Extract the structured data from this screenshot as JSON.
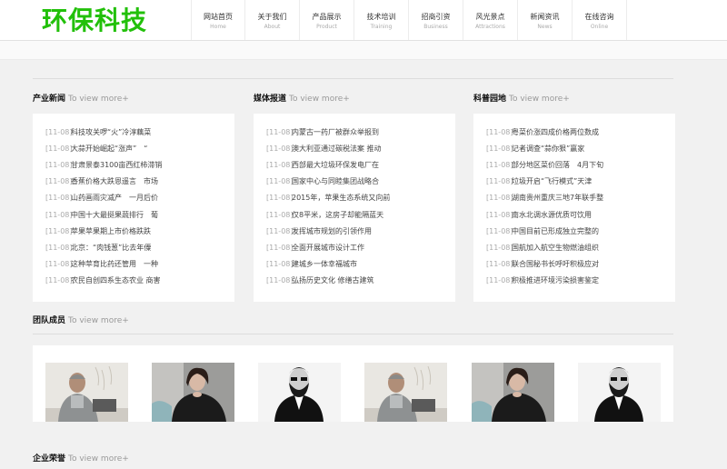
{
  "logo": "环保科技",
  "nav": [
    {
      "cn": "网站首页",
      "en": "Home"
    },
    {
      "cn": "关于我们",
      "en": "About"
    },
    {
      "cn": "产品展示",
      "en": "Product"
    },
    {
      "cn": "技术培训",
      "en": "Training"
    },
    {
      "cn": "招商引资",
      "en": "Business"
    },
    {
      "cn": "风光景点",
      "en": "Attractions"
    },
    {
      "cn": "新闻资讯",
      "en": "News"
    },
    {
      "cn": "在线咨询",
      "en": "Online"
    }
  ],
  "more_label": "To view more+",
  "sections": [
    {
      "title": "产业新闻",
      "items": [
        {
          "date": "[11-08]",
          "text": "科技攻关啰“火”冷淳藕菜"
        },
        {
          "date": "[11-08]",
          "text": "大蒜开始崛起“涨声”　“"
        },
        {
          "date": "[11-08]",
          "text": "甘肃景泰3100亩西红柿滞销"
        },
        {
          "date": "[11-08]",
          "text": "香蕉价格大跌恩遥言　市场"
        },
        {
          "date": "[11-08]",
          "text": "山药画雨灾减产　一月后价"
        },
        {
          "date": "[11-08]",
          "text": "中国十大最挺果蔬排行　葡"
        },
        {
          "date": "[11-08]",
          "text": "苹果苹果期上市价格跌跌"
        },
        {
          "date": "[11-08]",
          "text": "北京：“肉钱葱”比去年僳"
        },
        {
          "date": "[11-08]",
          "text": "这种苹育比药还管用　一种"
        },
        {
          "date": "[11-08]",
          "text": "农民自创四系生态农业 商害"
        }
      ]
    },
    {
      "title": "媒体报道",
      "items": [
        {
          "date": "[11-08]",
          "text": "内蒙古一药厂被群众举报到"
        },
        {
          "date": "[11-08]",
          "text": "澳大利亚通过碳税法案 推动"
        },
        {
          "date": "[11-08]",
          "text": "西部最大垃圾环保发电厂在"
        },
        {
          "date": "[11-08]",
          "text": "国家中心与同睦集团战略合"
        },
        {
          "date": "[11-08]",
          "text": "2015年，苹果生态系统又向前"
        },
        {
          "date": "[11-08]",
          "text": "仅8平米，这房子却能隔蓝天"
        },
        {
          "date": "[11-08]",
          "text": "发挥城市规划的引领作用"
        },
        {
          "date": "[11-08]",
          "text": "全面开展城市设计工作"
        },
        {
          "date": "[11-08]",
          "text": "建城乡一体幸福城市"
        },
        {
          "date": "[11-08]",
          "text": "弘扬历史文化 修缮古建筑"
        }
      ]
    },
    {
      "title": "科普园地",
      "items": [
        {
          "date": "[11-08]",
          "text": "粤菜价涨四成价格两位数成"
        },
        {
          "date": "[11-08]",
          "text": "记者调查“蒜你狠”赢家"
        },
        {
          "date": "[11-08]",
          "text": "部分地区菜价回落　4月下旬"
        },
        {
          "date": "[11-08]",
          "text": "垃圾开启“飞行模式”天津"
        },
        {
          "date": "[11-08]",
          "text": "湖南贵州重庆三地7年联手整"
        },
        {
          "date": "[11-08]",
          "text": "南水北调水源优质可饮用"
        },
        {
          "date": "[11-08]",
          "text": "中国目前已形成独立完整的"
        },
        {
          "date": "[11-08]",
          "text": "国航加入航空生物燃油组织"
        },
        {
          "date": "[11-08]",
          "text": "联合国秘书长呼吁积极应对"
        },
        {
          "date": "[11-08]",
          "text": "积极推进环境污染损害鉴定"
        }
      ]
    }
  ],
  "team_title": "团队成员",
  "team_photos": [
    "photo-man-grey-hair",
    "photo-woman-dark-hair",
    "photo-bearded-man",
    "photo-man-grey-hair",
    "photo-woman-dark-hair",
    "photo-bearded-man"
  ],
  "honor_title": "企业荣誉"
}
